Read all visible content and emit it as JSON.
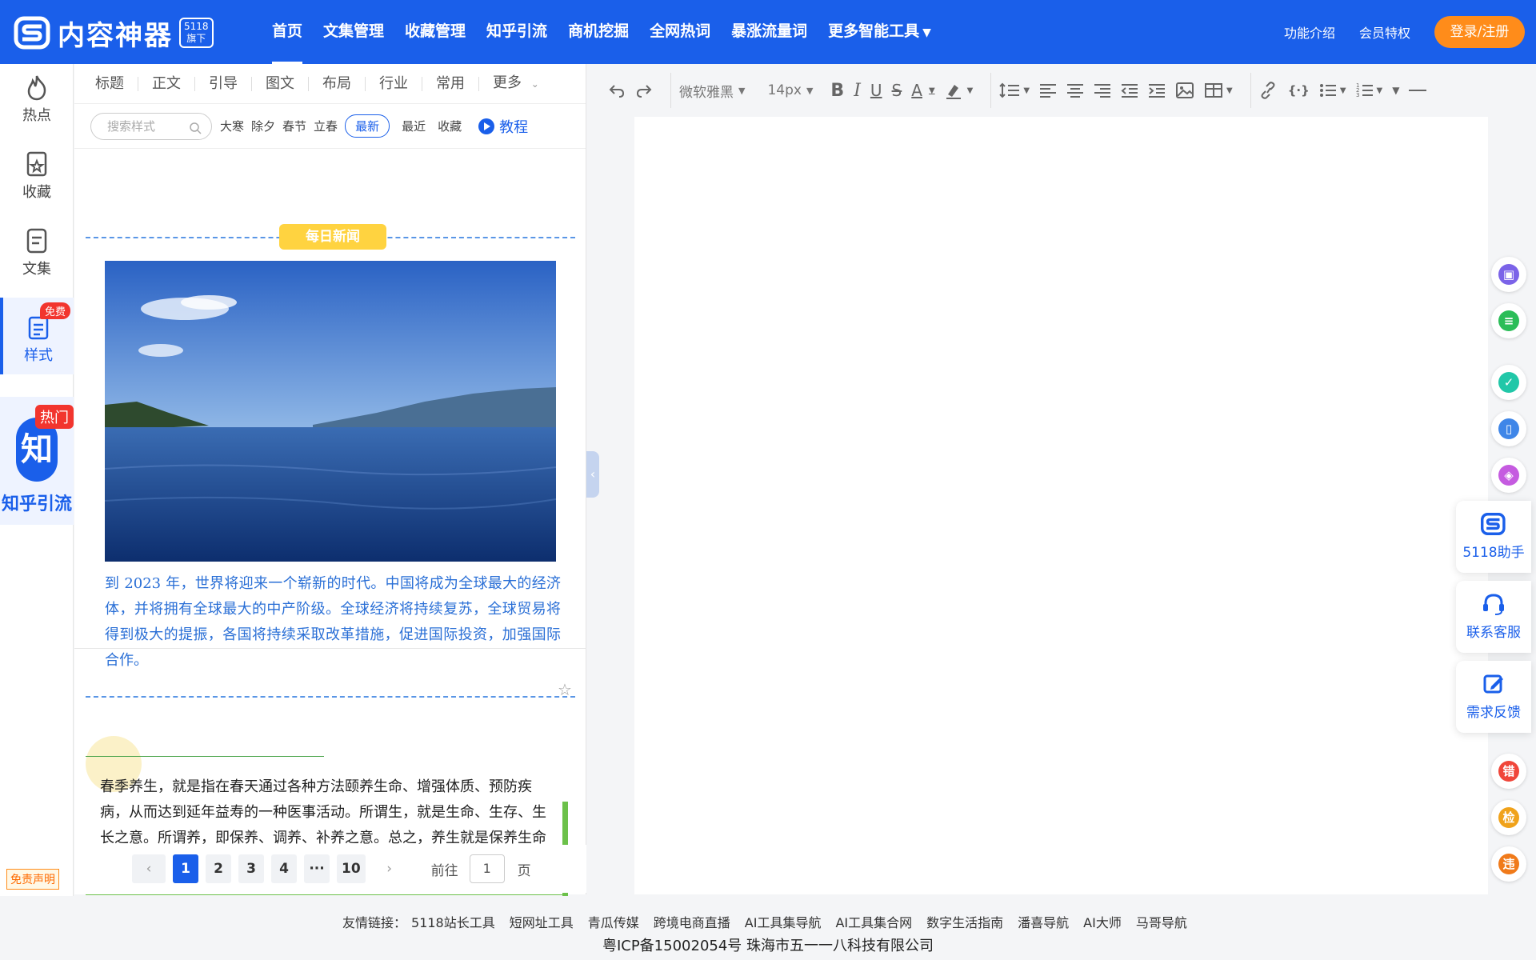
{
  "header": {
    "logo_text": "内容神器",
    "logo_badge_line1": "5118",
    "logo_badge_line2": "旗下",
    "nav": [
      "首页",
      "文集管理",
      "收藏管理",
      "知乎引流",
      "商机挖掘",
      "全网热词",
      "暴涨流量词",
      "更多智能工具"
    ],
    "feature_intro": "功能介绍",
    "member": "会员特权",
    "login": "登录/注册"
  },
  "leftrail": {
    "items": [
      {
        "label": "热点",
        "icon": "flame-icon"
      },
      {
        "label": "收藏",
        "icon": "star-doc-icon"
      },
      {
        "label": "文集",
        "icon": "document-icon"
      },
      {
        "label": "样式",
        "icon": "list-doc-icon"
      }
    ],
    "free_badge": "免费",
    "zhihu_char": "知",
    "hot_tag": "热门",
    "zhihu_label": "知乎引流",
    "disclaimer": "免责声明"
  },
  "panel": {
    "categories": [
      "标题",
      "正文",
      "引导",
      "图文",
      "布局",
      "行业",
      "常用",
      "更多"
    ],
    "search_placeholder": "搜索样式",
    "chips": [
      "大寒",
      "除夕",
      "春节",
      "立春"
    ],
    "filters": [
      "最新",
      "最近",
      "收藏"
    ],
    "selected_filter": "最新",
    "tutorial": "教程",
    "card1": {
      "tag": "每日新闻",
      "text": "到 2023 年，世界将迎来一个崭新的时代。中国将成为全球最大的经济体，并将拥有全球最大的中产阶级。全球经济将持续复苏，全球贸易将得到极大的提振，各国将持续采取改革措施，促进国际投资，加强国际合作。"
    },
    "card2": {
      "text": "春季养生，就是指在春天通过各种方法颐养生命、增强体质、预防疾病，从而达到延年益寿的一种医事活动。所谓生，就是生命、生存、生长之意。所谓养，即保养、调养、补养之意。总之，养生就是保养生命的意思。"
    },
    "pagination": {
      "pages": [
        "1",
        "2",
        "3",
        "4",
        "···",
        "10"
      ],
      "current": "1",
      "goto_label": "前往",
      "goto_value": "1",
      "page_unit": "页"
    }
  },
  "toolbar": {
    "font_family": "微软雅黑",
    "font_size": "14px"
  },
  "right_side": {
    "icon_colors": [
      "#7b63e8",
      "#2bbd58",
      "#21c7a8",
      "#3f86e8",
      "#c55be0",
      "#f0463a",
      "#f0a21a",
      "#f07a1a"
    ],
    "help_cards": [
      "5118助手",
      "联系客服",
      "需求反馈"
    ],
    "badge_chars": [
      "错",
      "检",
      "违"
    ]
  },
  "footer": {
    "links_label": "友情链接：",
    "links": [
      "5118站长工具",
      "短网址工具",
      "青瓜传媒",
      "跨境电商直播",
      "AI工具集导航",
      "AI工具集合网",
      "数字生活指南",
      "潘喜导航",
      "AI大师",
      "马哥导航"
    ],
    "icp": "粤ICP备15002054号 珠海市五一一八科技有限公司"
  }
}
